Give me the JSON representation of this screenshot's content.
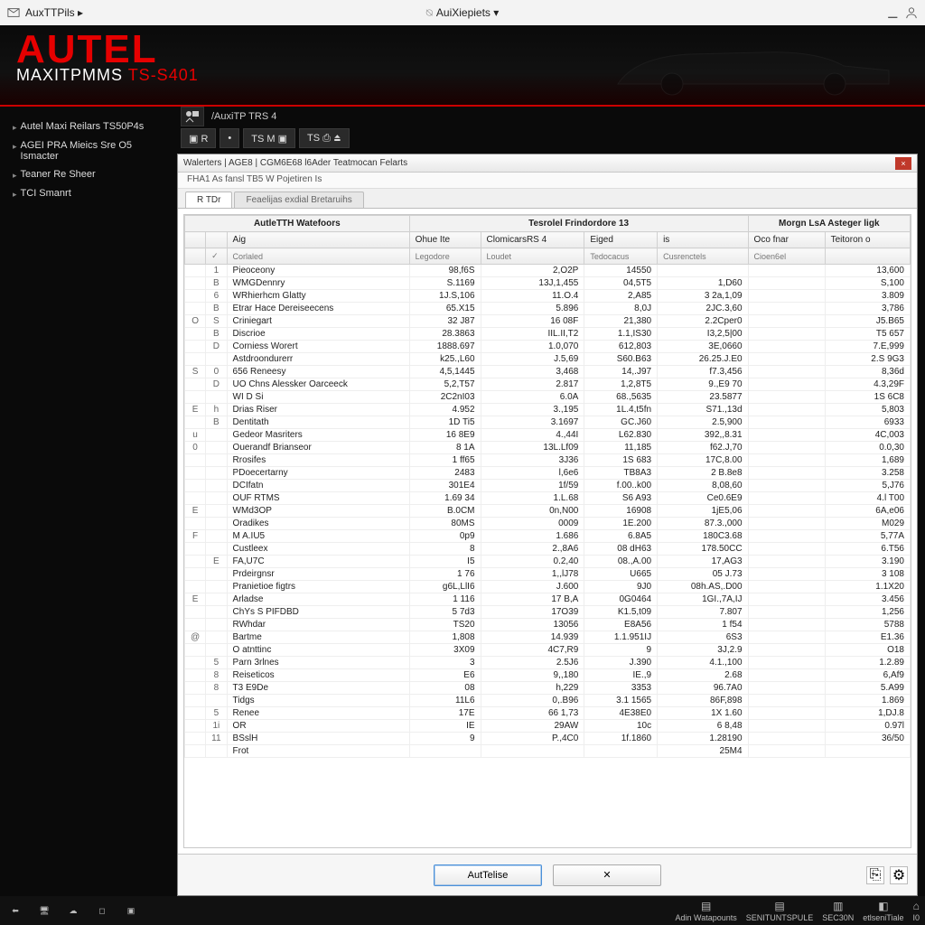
{
  "titlebar": {
    "app_label": "AuxTTPils ▸",
    "center_label": "AuiXiepiets ▾"
  },
  "logo": {
    "main": "AUTEL",
    "sub_prefix": "MAXITPMMS ",
    "sub_suffix": "TS-S401"
  },
  "sidebar": {
    "items": [
      {
        "label": "Autel Maxi Reilars TS50P4s"
      },
      {
        "label": "AGEI PRA Mieics Sre O5 Ismacter"
      },
      {
        "label": "Teaner Re Sheer"
      },
      {
        "label": "TCI Smanrt"
      }
    ]
  },
  "crumb": {
    "text": "/AuxiTP TRS 4"
  },
  "toolbar": {
    "btns": [
      "▣ R",
      "•",
      "TS M ▣",
      "TS ⎙ ⏏"
    ]
  },
  "panel": {
    "title": "Walerters | AGE8 | CGM6E68 l6Ader Teatmocan Felarts",
    "subtitle": "FHA1 As fansl TB5 W Pojetiren Is",
    "tabs": [
      "R TDr",
      "Feaelijas exdial Bretaruihs"
    ],
    "group_headers": [
      "AutleTTH Watefoors",
      "Tesrolel Frindordore       13",
      "Morgn LsA Asteger ligk"
    ],
    "columns": [
      "",
      "",
      "Aig",
      "Ohue Ite",
      "ClomicarsRS 4",
      "Eiged",
      "is",
      "Oco fnar",
      "Teitoron o"
    ],
    "sub_columns": [
      "",
      "✓",
      "Corlaled",
      "Legodore",
      "Loudet",
      "Tedocacus",
      "Cusrenctels",
      "Cioen6el",
      ""
    ],
    "rows": [
      [
        "",
        "1",
        "Pieoceony",
        "98,f6S",
        "2,O2P",
        "14550",
        "",
        "",
        "13,600"
      ],
      [
        "",
        "B",
        "WMGDennry",
        "S.1169",
        "13J,1,455",
        "04,5T5",
        "1,D60",
        "",
        "S,100"
      ],
      [
        "",
        "6",
        "WRhierhcm Glatty",
        "1J.S,106",
        "11.O.4",
        "2,A85",
        "3 2a,1,09",
        "",
        "3.809"
      ],
      [
        "",
        "B",
        "Etrar Hace Dereiseecens",
        "65.X15",
        "5.896",
        "8,0J",
        "2JC.3,60",
        "",
        "3,786"
      ],
      [
        "O",
        "S",
        "Criniegart",
        "32 J87",
        "16 08F",
        "21,380",
        "2.2Cper0",
        "",
        "J5.B65"
      ],
      [
        "",
        "B",
        "Discrioe",
        "28.3863",
        "IIL.II,T2",
        "1.1,IS30",
        "I3,2,5|00",
        "",
        "T5 657"
      ],
      [
        "",
        "D",
        "Corniess Worert",
        "1888.697",
        "1.0,070",
        "612,803",
        "3E,0660",
        "",
        "7.E,999"
      ],
      [
        "",
        "",
        "Astdroondurerr",
        "k25.,L60",
        "J.5,69",
        "S60.B63",
        "26.25.J.E0",
        "",
        "2.S 9G3"
      ],
      [
        "S",
        "0",
        "656 Reneesy",
        "4,5,1445",
        "3,468",
        "14,.J97",
        "f7.3,456",
        "",
        "8,36d"
      ],
      [
        "",
        "D",
        "UO Chns Alessker Oarceeck",
        "5,2,T57",
        "2.817",
        "1,2,8T5",
        "9.,E9 70",
        "",
        "4.3,29F"
      ],
      [
        "",
        "",
        "WI D Si",
        "2C2nI03",
        "6.0A",
        "68.,5635",
        "23.5877",
        "",
        "1S 6C8"
      ],
      [
        "E",
        "h",
        "Drias Riser",
        "4.952",
        "3.,195",
        "1L.4,t5fn",
        "S71.,13d",
        "",
        "5,803"
      ],
      [
        "",
        "B",
        "Dentitath",
        "1D Ti5",
        "3.1697",
        "GC.J60",
        "2.5,900",
        "",
        "6933"
      ],
      [
        "u",
        "",
        "Gedeor Masriters",
        "16 8E9",
        "4.,44I",
        "L62.830",
        "392,,8.31",
        "",
        "4C,003"
      ],
      [
        "0",
        "",
        "Ouerandf Brianseor",
        "8 1A",
        "13L.Lf09",
        "11,185",
        "f62.J,70",
        "",
        "0.0,30"
      ],
      [
        "",
        "",
        "Rrosifes",
        "1 ff65",
        "3J36",
        "1S 683",
        "17C,8.00",
        "",
        "1,689"
      ],
      [
        "",
        "",
        "PDoecertarny",
        "2483",
        "l,6e6",
        "TB8A3",
        "2 B.8e8",
        "",
        "3.258"
      ],
      [
        "",
        "",
        "DCIfatn",
        "301E4",
        "1f/59",
        "f.00..k00",
        "8,08,60",
        "",
        "5,J76"
      ],
      [
        "",
        "",
        "OUF RTMS",
        "1.69 34",
        "1.L.68",
        "S6 A93",
        "Ce0.6E9",
        "",
        "4.l T00"
      ],
      [
        "E",
        "",
        "WMd3OP",
        "B.0CM",
        "0n,N00",
        "16908",
        "1jE5,06",
        "",
        "6A,e06"
      ],
      [
        "",
        "",
        "Oradikes",
        "80MS",
        "0009",
        "1E.200",
        "87.3.,000",
        "",
        "M029"
      ],
      [
        "F",
        "",
        "M A.IU5",
        "0p9",
        "1.686",
        "6.8A5",
        "180C3.68",
        "",
        "5,77A"
      ],
      [
        "",
        "",
        "Custleex",
        "8",
        "2.,8A6",
        "08 dH63",
        "178.50CC",
        "",
        "6.T56"
      ],
      [
        "",
        "E",
        "FA,U7C",
        "I5",
        "0.2,40",
        "08.,A.00",
        "17,AG3",
        "",
        "3.190"
      ],
      [
        "",
        "",
        "Prdeirgnsr",
        "1 76",
        "1,,lJ78",
        "U665",
        "05 J.73",
        "",
        "3 108"
      ],
      [
        "",
        "",
        "Pranietioe figtrs",
        "g6L,LlI6",
        "J.600",
        "9J0",
        "08h.AS,.D00",
        "",
        "1.1X20"
      ],
      [
        "E",
        "",
        "Arladse",
        "1 116",
        "17 B,A",
        "0G0464",
        "1GI.,7A,IJ",
        "",
        "3.456"
      ],
      [
        "",
        "",
        "ChYs S PIFDBD",
        "5 7d3",
        "17O39",
        "K1.5,t09",
        "7.807",
        "",
        "1,256"
      ],
      [
        "",
        "",
        "RWhdar",
        "TS20",
        "13056",
        "E8A56",
        "1 f54",
        "",
        "5788"
      ],
      [
        "@",
        "",
        "Bartme",
        "1,808",
        "14.939",
        "1.1.951IJ",
        "6S3",
        "",
        "E1.36"
      ],
      [
        "",
        "",
        "O atnttinc",
        "3X09",
        "4C7,R9",
        "9",
        "3J,2.9",
        "",
        "O18"
      ],
      [
        "",
        "5",
        "Parn 3rlnes",
        "3",
        "2.5J6",
        "J.390",
        "4.1.,100",
        "",
        "1.2.89"
      ],
      [
        "",
        "8",
        "Reiseticos",
        "E6",
        "9,,180",
        "IE.,9",
        "2.68",
        "",
        "6,Af9"
      ],
      [
        "",
        "8",
        "T3 E9De",
        "08",
        "h,229",
        "3353",
        "96.7A0",
        "",
        "5.A99"
      ],
      [
        "",
        "",
        "Tidgs",
        "11L6",
        "0,.B96",
        "3.1 1565",
        "86F,898",
        "",
        "1.869"
      ],
      [
        "",
        "5",
        "Renee",
        "17E",
        "66 1,73",
        "4E38E0",
        "1X 1.60",
        "",
        "1,DJ.8"
      ],
      [
        "",
        "1i",
        "OR",
        "IE",
        "29AW",
        "10c",
        "6 8,48",
        "",
        "0.97l"
      ],
      [
        "",
        "11",
        "BSslH",
        "9",
        "P.,4C0",
        "1f.1860",
        "1.28190",
        "",
        "36/50"
      ],
      [
        "",
        "",
        "Frot",
        "",
        "",
        "",
        "25M4",
        "",
        ""
      ]
    ],
    "footer": {
      "primary_btn": "AutTelise",
      "cancel_btn": "✕"
    }
  },
  "taskbar": {
    "tray": [
      {
        "icon": "▤",
        "label": "Adin Watapounts"
      },
      {
        "icon": "▤",
        "label": "SENITUNTSPULE"
      },
      {
        "icon": "▥",
        "label": "SEC30N"
      },
      {
        "icon": "◧",
        "label": "etlseniTiale"
      },
      {
        "icon": "⌂",
        "label": "I0"
      }
    ]
  }
}
